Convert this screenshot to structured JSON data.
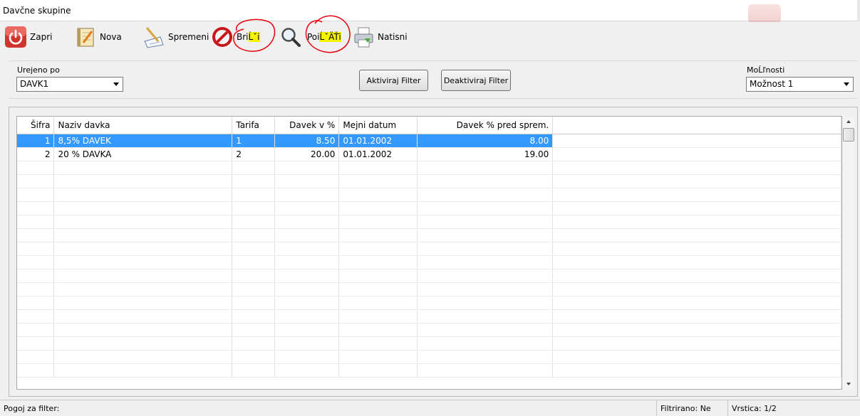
{
  "window": {
    "title": "Davčne skupine"
  },
  "toolbar": {
    "zapri": "Zapri",
    "nova": "Nova",
    "spremeni": "Spremeni",
    "brisi_prefix": "Bri",
    "brisi_highlight": "Ĺˇi",
    "poisci_prefix": "Poi",
    "poisci_highlight": "ĹˇÄŤi",
    "natisni": "Natisni",
    "icons": {
      "zapri": "power-icon",
      "nova": "notepad-icon",
      "spremeni": "edit-paper-icon",
      "brisi": "prohibited-icon",
      "poisci": "magnifier-icon",
      "natisni": "printer-icon"
    }
  },
  "filter": {
    "urejeno_label": "Urejeno po",
    "urejeno_value": "DAVK1",
    "aktiviraj": "Aktiviraj Filter",
    "deaktiviraj": "Deaktiviraj Filter",
    "moznosti_label": "MoĹľnosti",
    "moznost_value": "Možnost 1"
  },
  "grid": {
    "columns": [
      "Šifra",
      "Naziv davka",
      "Tarifa",
      "Davek v %",
      "Mejni datum",
      "Davek % pred sprem."
    ],
    "rows": [
      {
        "sifra": "1",
        "naziv": "8,5% DAVEK",
        "tarifa": "1",
        "davek": "8.50",
        "datum": "01.01.2002",
        "pred": "8.00",
        "selected": true
      },
      {
        "sifra": "2",
        "naziv": "20 % DAVKA",
        "tarifa": "2",
        "davek": "20.00",
        "datum": "01.01.2002",
        "pred": "19.00",
        "selected": false
      }
    ]
  },
  "status": {
    "pogoj": "Pogoj za filter:",
    "filtrirano": "Filtrirano: Ne",
    "vrstica": "Vrstica: 1/2"
  },
  "colors": {
    "selection": "#3399ff",
    "highlight": "#f5f300",
    "annotation": "#e8000d"
  }
}
